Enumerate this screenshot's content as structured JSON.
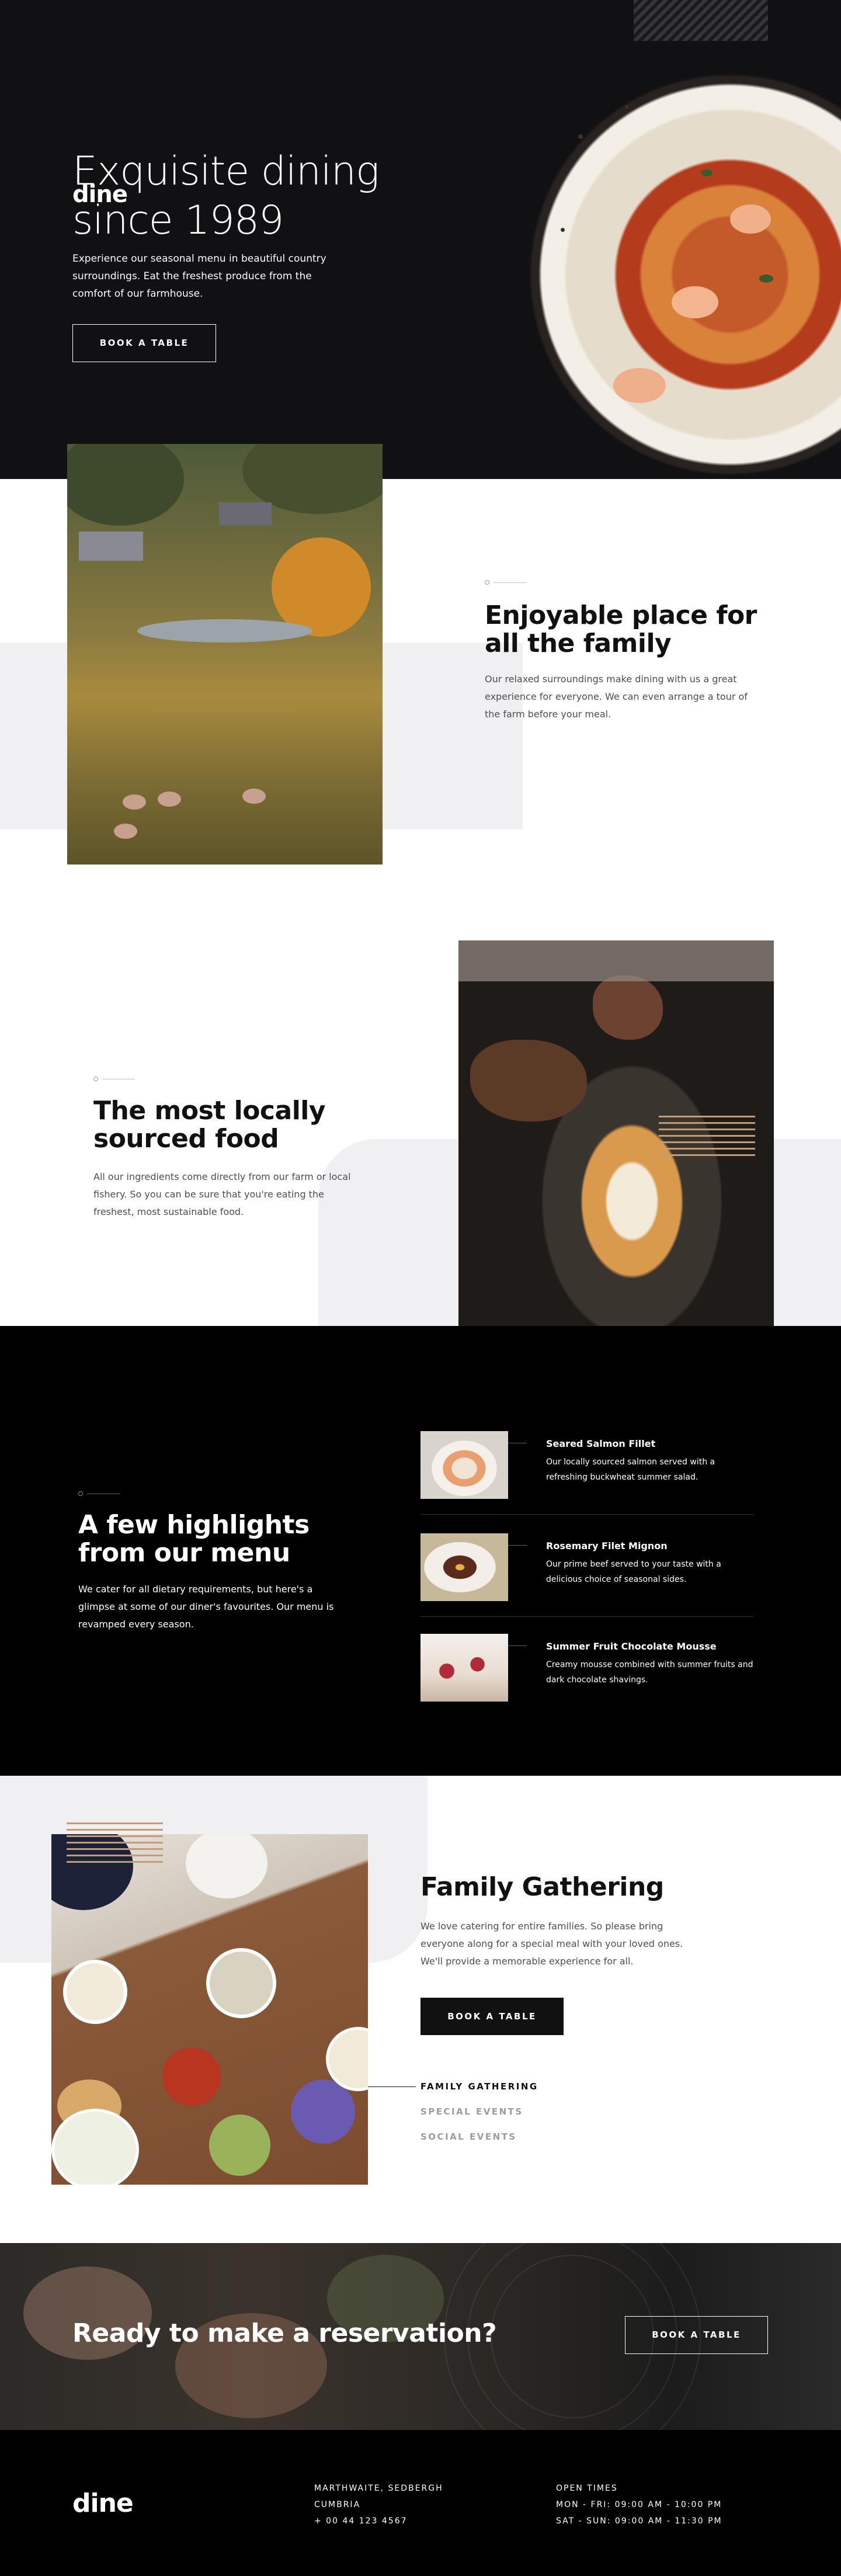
{
  "brand": {
    "name": "dine"
  },
  "hero": {
    "title_line1": "Exquisite dining",
    "title_line2": "since 1989",
    "description": "Experience our seasonal menu in beautiful country surroundings. Eat the freshest produce from the comfort of our farmhouse.",
    "cta_label": "BOOK A TABLE"
  },
  "enjoyable": {
    "title": "Enjoyable place for all the family",
    "text": "Our relaxed surroundings make dining with us a great experience for everyone. We can even arrange a tour of the farm before your meal."
  },
  "local": {
    "title": "The most locally sourced food",
    "text": "All our ingredients come directly from our farm or local fishery. So you can be sure that you're eating the freshest, most sustainable food."
  },
  "highlights": {
    "title": "A few highlights from our menu",
    "text": "We cater for all dietary requirements, but here's a glimpse at some of our diner's favourites. Our menu is revamped every season.",
    "items": [
      {
        "title": "Seared Salmon Fillet",
        "desc": "Our locally sourced salmon served with a refreshing buckwheat summer salad."
      },
      {
        "title": "Rosemary Filet Mignon",
        "desc": "Our prime beef served to your taste with a delicious choice of seasonal sides."
      },
      {
        "title": "Summer Fruit Chocolate Mousse",
        "desc": "Creamy mousse combined with summer fruits and dark chocolate shavings."
      }
    ]
  },
  "events": {
    "title": "Family Gathering",
    "text": "We love catering for entire families. So please bring everyone along for a special meal with your loved ones. We'll provide a memorable experience for all.",
    "cta_label": "BOOK A TABLE",
    "tabs": [
      "FAMILY GATHERING",
      "SPECIAL EVENTS",
      "SOCIAL EVENTS"
    ],
    "active_tab": "FAMILY GATHERING"
  },
  "reservation": {
    "title": "Ready to make a reservation?",
    "cta_label": "BOOK A TABLE"
  },
  "footer": {
    "logo": "dine",
    "address_line1": "MARTHWAITE, SEDBERGH",
    "address_line2": "CUMBRIA",
    "phone": "+ 00 44 123 4567",
    "hours_title": "OPEN TIMES",
    "hours_weekday": "MON - FRI: 09:00 AM - 10:00 PM",
    "hours_weekend": "SAT - SUN: 09:00 AM - 11:30 PM"
  },
  "colors": {
    "dark": "#111113",
    "black": "#000000",
    "light_band": "#f0f0f2",
    "accent_stripe": "#c59b77",
    "muted_tab": "#9b9ba4"
  },
  "icons": [
    "plate-of-pasta-image",
    "countryside-photo",
    "plating-photo",
    "family-meal-photo"
  ]
}
